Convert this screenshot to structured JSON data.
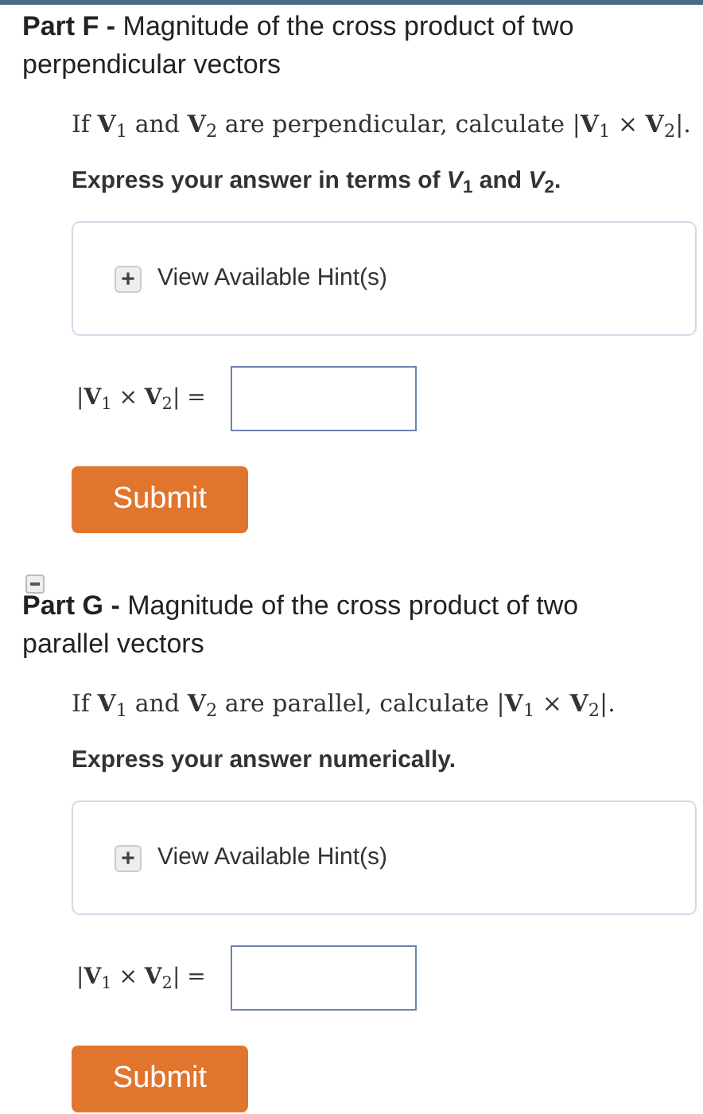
{
  "parts": [
    {
      "collapsible": false,
      "title": "**Part F -** Magnitude of the cross product of two perpendicular vectors",
      "prompt": "If **V**$_{1}$ and **V**$_{2}$ are perpendicular, calculate |**V**$_{1}$ × **V**$_{2}$|.",
      "instruction": "Express your answer in terms of *V*$_{1}$ and *V*$_{2}$.",
      "hint_icon": "+",
      "hint": "View Available Hint(s)",
      "answer_label": "|**V**$_{1}$ × **V**$_{2}$| =",
      "submit": "Submit"
    },
    {
      "collapsible": true,
      "title": "**Part G -** Magnitude of the cross product of two parallel vectors",
      "prompt": "If **V**$_{1}$ and **V**$_{2}$ are parallel, calculate |**V**$_{1}$ × **V**$_{2}$|.",
      "instruction": "Express your answer numerically.",
      "hint_icon": "+",
      "hint": "View Available Hint(s)",
      "answer_label": "|**V**$_{1}$ × **V**$_{2}$| =",
      "submit": "Submit"
    }
  ]
}
